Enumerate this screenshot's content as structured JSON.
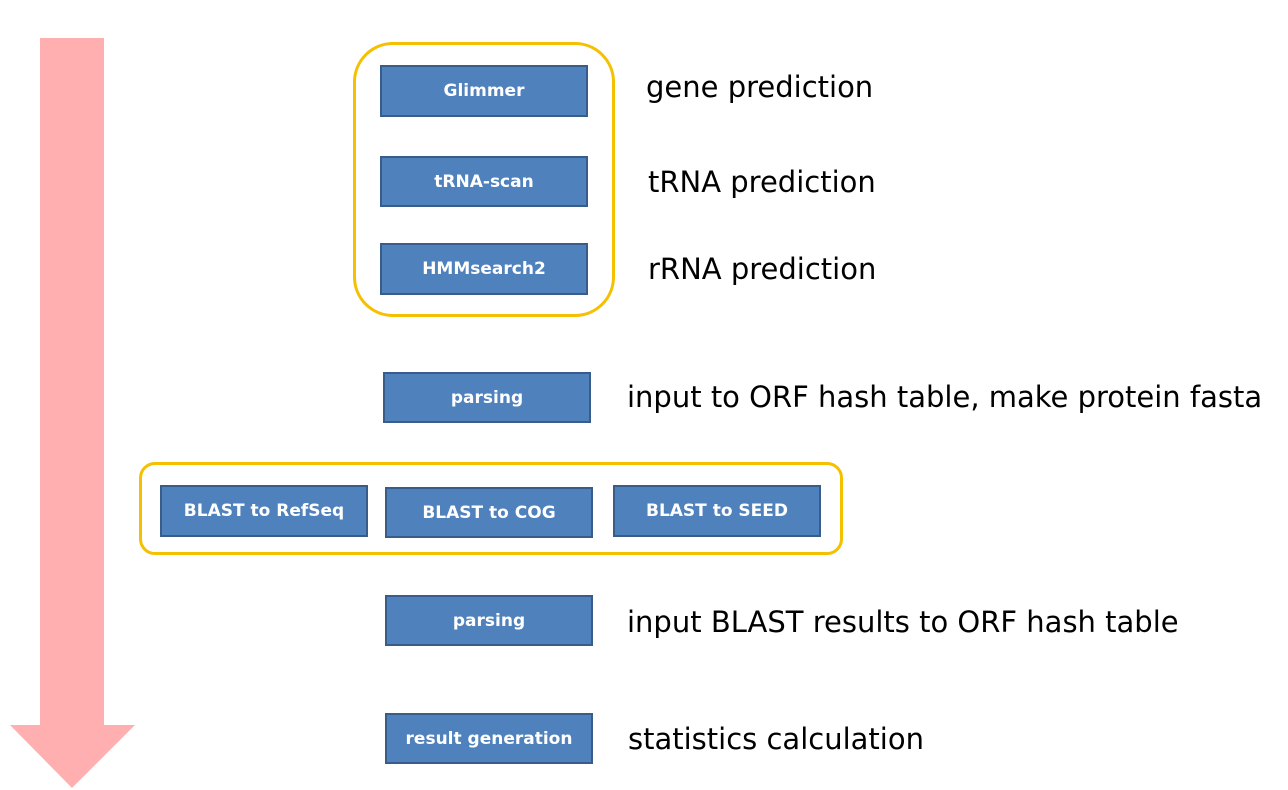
{
  "colors": {
    "box_fill": "#4F81BD",
    "box_border": "#385D8A",
    "group_border": "#F5C000",
    "arrow": "#FFAFAF"
  },
  "steps": {
    "glimmer": {
      "box": "Glimmer",
      "label": "gene prediction"
    },
    "trna": {
      "box": "tRNA-scan",
      "label": "tRNA prediction"
    },
    "hmm": {
      "box": "HMMsearch2",
      "label": "rRNA prediction"
    },
    "parsing1": {
      "box": "parsing",
      "label": "input to ORF hash table, make protein fasta"
    },
    "blast": {
      "refseq": "BLAST to RefSeq",
      "cog": "BLAST to COG",
      "seed": "BLAST to SEED"
    },
    "parsing2": {
      "box": "parsing",
      "label": "input BLAST results to ORF hash table"
    },
    "result": {
      "box": "result generation",
      "label": "statistics calculation"
    }
  }
}
